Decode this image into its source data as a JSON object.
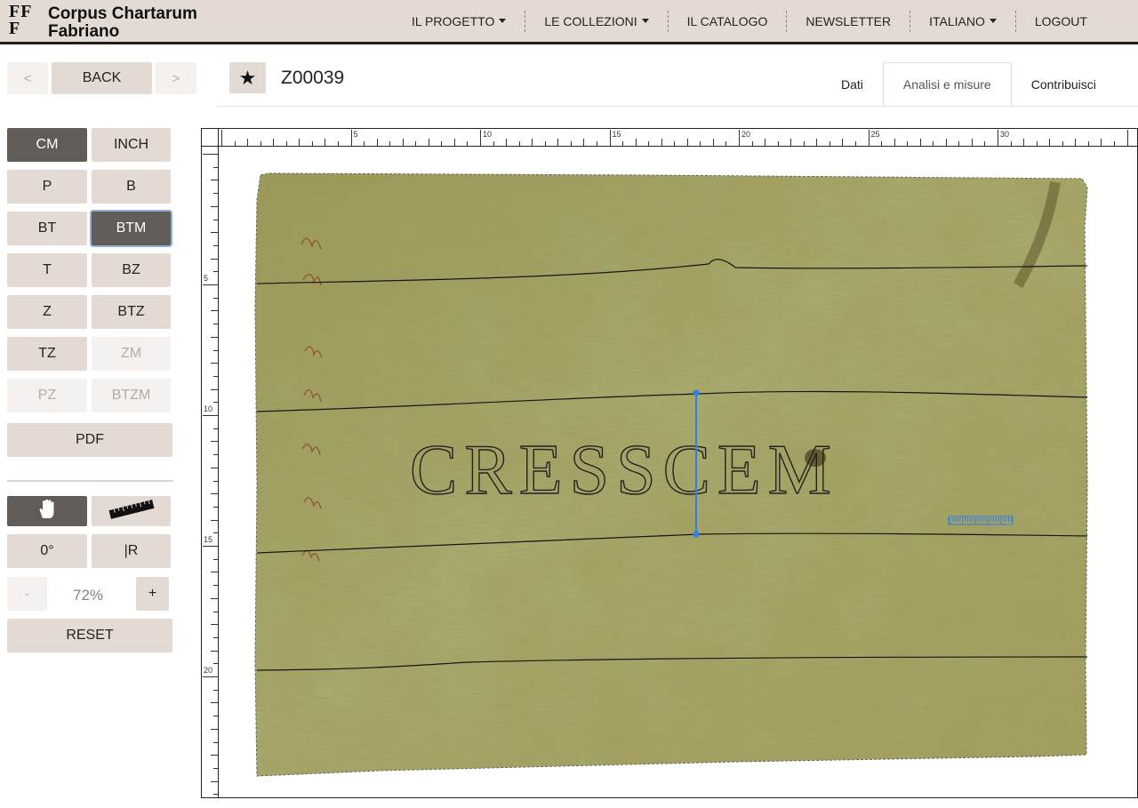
{
  "header": {
    "logo_mark": "FF\nF",
    "brand_line1": "Corpus Chartarum",
    "brand_line2": "Fabriano",
    "nav": [
      {
        "label": "IL PROGETTO",
        "dropdown": true
      },
      {
        "label": "LE COLLEZIONI",
        "dropdown": true
      },
      {
        "label": "IL CATALOGO",
        "dropdown": false
      },
      {
        "label": "NEWSLETTER",
        "dropdown": false
      },
      {
        "label": "ITALIANO",
        "dropdown": true
      },
      {
        "label": "LOGOUT",
        "dropdown": false
      }
    ]
  },
  "subheader": {
    "prev": "<",
    "back": "BACK",
    "next": ">",
    "star": "★",
    "record_id": "Z00039",
    "tabs": [
      {
        "label": "Dati",
        "active": false
      },
      {
        "label": "Analisi e misure",
        "active": true
      },
      {
        "label": "Contribuisci",
        "active": false
      }
    ]
  },
  "sidebar": {
    "unit_cm": "CM",
    "unit_inch": "INCH",
    "layers": [
      {
        "label": "P",
        "state": "normal"
      },
      {
        "label": "B",
        "state": "normal"
      },
      {
        "label": "BT",
        "state": "normal"
      },
      {
        "label": "BTM",
        "state": "selected"
      },
      {
        "label": "T",
        "state": "normal"
      },
      {
        "label": "BZ",
        "state": "normal"
      },
      {
        "label": "Z",
        "state": "normal"
      },
      {
        "label": "BTZ",
        "state": "normal"
      },
      {
        "label": "TZ",
        "state": "normal"
      },
      {
        "label": "ZM",
        "state": "disabled"
      },
      {
        "label": "PZ",
        "state": "disabled"
      },
      {
        "label": "BTZM",
        "state": "disabled"
      }
    ],
    "pdf": "PDF",
    "rotation": "0°",
    "mirror": "|R",
    "zoom_minus": "-",
    "zoom_value": "72%",
    "zoom_plus": "+",
    "reset": "RESET"
  },
  "viewer": {
    "h_ruler_labels": [
      "5",
      "10",
      "15",
      "20",
      "25",
      "30"
    ],
    "v_ruler_labels": [
      "5",
      "10",
      "15",
      "20"
    ],
    "watermark_text": "CRESSCEM"
  },
  "colors": {
    "nav_bg": "#e3dbd3",
    "button_bg": "#e3dbd3",
    "button_active": "#615c58",
    "measure_line": "#2f7fe6",
    "paper": "#a9a765"
  }
}
